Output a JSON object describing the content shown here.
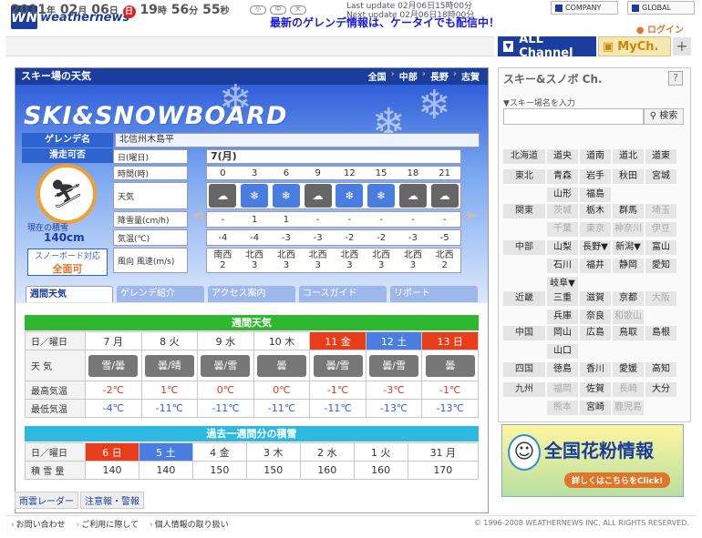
{
  "header": {
    "logo_mark": "WN",
    "logo_word": "weathernews",
    "promo": "最新のゲレンデ情報は、ケータイでも配信中！",
    "company": "COMPANY",
    "global": "GLOBAL",
    "login": "ログイン"
  },
  "datebar": {
    "year": "2011",
    "year_unit": "年",
    "month": "02",
    "month_unit": "月",
    "day": "06",
    "day_unit": "日",
    "weekday": "日",
    "hour": "19",
    "hour_unit": "時",
    "minute": "56",
    "minute_unit": "分",
    "second": "55",
    "second_unit": "秒",
    "view_buttons": [
      "小",
      "中",
      "大"
    ],
    "last_update": "Last update  02月06日15時00分",
    "next_update": "Next update  02月06日18時00分",
    "all_channel": "ALL Channel",
    "my_ch": "MyCh.",
    "plus": "+"
  },
  "main": {
    "title": "スキー場の天気",
    "crumbs": [
      "全国",
      "中部",
      "長野",
      "志賀"
    ],
    "ski_title": "SKI&SNOWBOARD",
    "slope_label": "ゲレンデ名",
    "slope_name": "北信州木島平",
    "status_label": "滑走可否",
    "current_snow_label": "現在の積雪",
    "current_snow": "140cm",
    "snowboard_label": "スノーボード対応",
    "snowboard_value": "全面可",
    "forecast": {
      "day_label": "日(曜日)",
      "day": "7(月)",
      "time_label": "時間(時)",
      "hours": [
        "0",
        "3",
        "6",
        "9",
        "12",
        "15",
        "18",
        "21"
      ],
      "weather_label": "天気",
      "weather": [
        "cloud",
        "snow",
        "snow",
        "cloud",
        "snow",
        "snow",
        "cloud",
        "cloud"
      ],
      "snowfall_label": "降雪量(cm/h)",
      "snowfall": [
        "-",
        "1",
        "1",
        "-",
        "-",
        "-",
        "-",
        "-"
      ],
      "temp_label": "気温(℃)",
      "temps": [
        "-4",
        "-4",
        "-3",
        "-3",
        "-2",
        "-2",
        "-3",
        "-5"
      ],
      "wind_label": "風向 風速(m/s)",
      "wind_dir": [
        "南西",
        "北西",
        "北西",
        "北西",
        "北西",
        "北西",
        "北西",
        "北西"
      ],
      "wind_speed": [
        "2",
        "3",
        "3",
        "3",
        "3",
        "3",
        "3",
        "2"
      ]
    },
    "tabs": [
      "週間天気",
      "ゲレンデ紹介",
      "アクセス案内",
      "コースガイド",
      "リポート"
    ],
    "weekly": {
      "title": "週間天気",
      "head_label": "日／曜日",
      "days": [
        "7 月",
        "8 火",
        "9 水",
        "10 木",
        "11 金",
        "12 土",
        "13 日"
      ],
      "day_kind": [
        "",
        "",
        "",
        "",
        "sun",
        "sat",
        "sun"
      ],
      "weather_label": "天 気",
      "weather": [
        "雪/曇",
        "曇/晴",
        "曇/雪",
        "曇",
        "曇/雪",
        "曇/雪",
        "曇"
      ],
      "max_label": "最高気温",
      "max": [
        "-2℃",
        "1℃",
        "0℃",
        "0℃",
        "-1℃",
        "-3℃",
        "-1℃"
      ],
      "min_label": "最低気温",
      "min": [
        "-4℃",
        "-11℃",
        "-11℃",
        "-11℃",
        "-11℃",
        "-13℃",
        "-13℃"
      ]
    },
    "past": {
      "title": "過去一週間分の積雪",
      "head_label": "日／曜日",
      "days": [
        "6 日",
        "5 土",
        "4 金",
        "3 木",
        "2 水",
        "1 火",
        "31 月"
      ],
      "day_kind": [
        "sun",
        "sat",
        "",
        "",
        "",
        "",
        ""
      ],
      "snow_label": "積 雪 量",
      "snow": [
        "140",
        "140",
        "150",
        "150",
        "160",
        "160",
        "170"
      ]
    },
    "bottom_links": [
      "雨雲レーダー",
      "注意報・警報"
    ]
  },
  "side": {
    "title": "スキー&スノボ Ch.",
    "help": "?",
    "search_label": "▼スキー場名を入力",
    "search_placeholder": "",
    "search_button": "検索",
    "regions": [
      {
        "name": "北海道",
        "prefs": [
          "道央",
          "道南",
          "道北",
          "道東"
        ],
        "dim": []
      },
      {
        "name": "東北",
        "prefs": [
          "青森",
          "岩手",
          "秋田",
          "宮城",
          "山形",
          "福島"
        ],
        "dim": []
      },
      {
        "name": "関東",
        "prefs": [
          "茨城",
          "栃木",
          "群馬",
          "埼玉",
          "千葉",
          "東京",
          "神奈川",
          "伊豆"
        ],
        "dim": [
          "茨城",
          "埼玉",
          "千葉",
          "東京",
          "神奈川",
          "伊豆"
        ]
      },
      {
        "name": "中部",
        "prefs": [
          "山梨",
          "長野▼",
          "新潟▼",
          "富山",
          "石川",
          "福井",
          "静岡",
          "愛知",
          "岐阜▼"
        ],
        "dim": []
      },
      {
        "name": "近畿",
        "prefs": [
          "三重",
          "滋賀",
          "京都",
          "大阪",
          "兵庫",
          "奈良",
          "和歌山"
        ],
        "dim": [
          "大阪",
          "和歌山"
        ]
      },
      {
        "name": "中国",
        "prefs": [
          "岡山",
          "広島",
          "鳥取",
          "島根",
          "山口"
        ],
        "dim": []
      },
      {
        "name": "四国",
        "prefs": [
          "徳島",
          "香川",
          "愛媛",
          "高知"
        ],
        "dim": []
      },
      {
        "name": "九州",
        "prefs": [
          "福岡",
          "佐賀",
          "長崎",
          "大分",
          "熊本",
          "宮崎",
          "鹿児島"
        ],
        "dim": [
          "福岡",
          "長崎",
          "熊本",
          "鹿児島"
        ]
      }
    ],
    "pollen_title": "全国花粉情報",
    "pollen_button": "詳しくはこちらをClick!"
  },
  "footer": {
    "links": [
      "お問い合わせ",
      "ご利用に際して",
      "個人情報の取り扱い"
    ],
    "copyright": "© 1996-2008 WEATHERNEWS INC. ALL RIGHTS RESERVED."
  }
}
